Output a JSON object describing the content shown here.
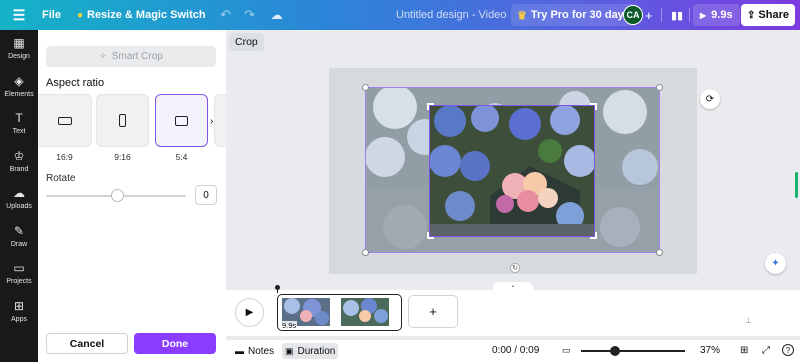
{
  "topbar": {
    "menu_icon": "menu-icon",
    "file_label": "File",
    "resize_label": "Resize & Magic Switch",
    "design_title": "Untitled design - Video",
    "trypro_label": "Try Pro for 30 days",
    "avatar_initials": "CA",
    "play_duration": "9.9s",
    "share_label": "Share",
    "gradient_colors": [
      "#14b3c7",
      "#2b86d8",
      "#5a5fe0",
      "#7c3ae0"
    ]
  },
  "rail": {
    "items": [
      {
        "label": "Design",
        "icon": "design-icon"
      },
      {
        "label": "Elements",
        "icon": "elements-icon"
      },
      {
        "label": "Text",
        "icon": "text-icon"
      },
      {
        "label": "Brand",
        "icon": "brand-icon"
      },
      {
        "label": "Uploads",
        "icon": "uploads-icon"
      },
      {
        "label": "Draw",
        "icon": "draw-icon"
      },
      {
        "label": "Projects",
        "icon": "projects-icon"
      },
      {
        "label": "Apps",
        "icon": "apps-icon"
      }
    ]
  },
  "panel": {
    "smart_crop_label": "Smart Crop",
    "aspect_ratio_heading": "Aspect ratio",
    "ratios": [
      {
        "label": "16:9",
        "selected": false
      },
      {
        "label": "9:16",
        "selected": false
      },
      {
        "label": "5:4",
        "selected": true
      }
    ],
    "rotate_heading": "Rotate",
    "rotate_value": "0",
    "rotate_fraction": 0.5,
    "cancel_label": "Cancel",
    "done_label": "Done",
    "accent_color": "#8b3dff"
  },
  "canvas": {
    "crop_label": "Crop"
  },
  "timeline": {
    "clip_duration": "9.9s"
  },
  "footer": {
    "notes_label": "Notes",
    "duration_label": "Duration",
    "time_readout": "0:00 / 0:09",
    "zoom_value": "37%",
    "zoom_fraction": 0.33
  }
}
